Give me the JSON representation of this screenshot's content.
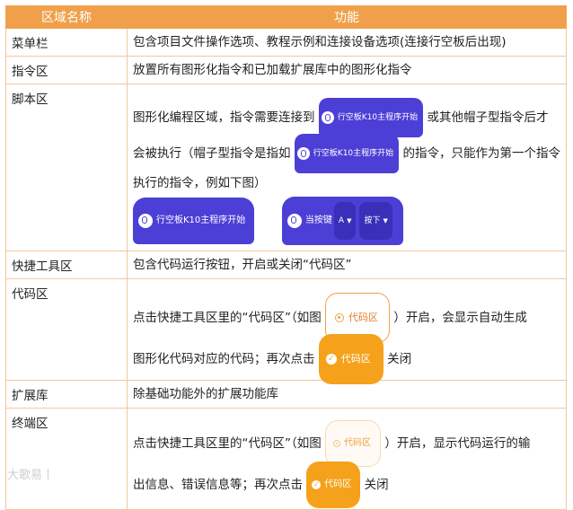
{
  "header": {
    "col_name": "区域名称",
    "col_func": "功能"
  },
  "rows": {
    "menu": {
      "name": "菜单栏",
      "desc": "包含项目文件操作选项、教程示例和连接设备选项(连接行空板后出现)"
    },
    "cmd": {
      "name": "指令区",
      "desc": "放置所有图形化指令和已加载扩展库中的图形化指令"
    },
    "script": {
      "name": "脚本区",
      "l1a": "图形化编程区域，指令需要连接到",
      "l1b": "或其他帽子型指令后才",
      "l2a": "会被执行（帽子型指令是指如",
      "l2b": "的指令，只能作为第一个指令",
      "l3": "执行的指令，例如下图）",
      "hat_label": "行空板K10主程序开始",
      "hat2_prefix": "当按键",
      "hat2_key": "A",
      "hat2_action": "按下"
    },
    "tool": {
      "name": "快捷工具区",
      "desc": "包含代码运行按钮，开启或关闭“代码区”"
    },
    "code": {
      "name": "代码区",
      "l1a": "点击快捷工具区里的“代码区”（如图",
      "l1b": "）开启，会显示自动生成",
      "l2a": "图形化代码对应的代码；再次点击",
      "l2b": "关闭",
      "btn_label": "代码区"
    },
    "ext": {
      "name": "扩展库",
      "desc": "除基础功能外的扩展功能库"
    },
    "term": {
      "name": "终端区",
      "l1a": "点击快捷工具区里的“代码区”（如图",
      "l1b": "）开启，显示代码运行的输",
      "l2a": "出信息、错误信息等；再次点击",
      "l2b": "关闭",
      "btn_label": "代码区"
    }
  },
  "watermark": "大歌易丨",
  "colors": {
    "header_bg": "#f0a04b",
    "border": "#f2c79a",
    "hat_block": "#4c3fd6",
    "code_btn": "#f5a11b"
  }
}
